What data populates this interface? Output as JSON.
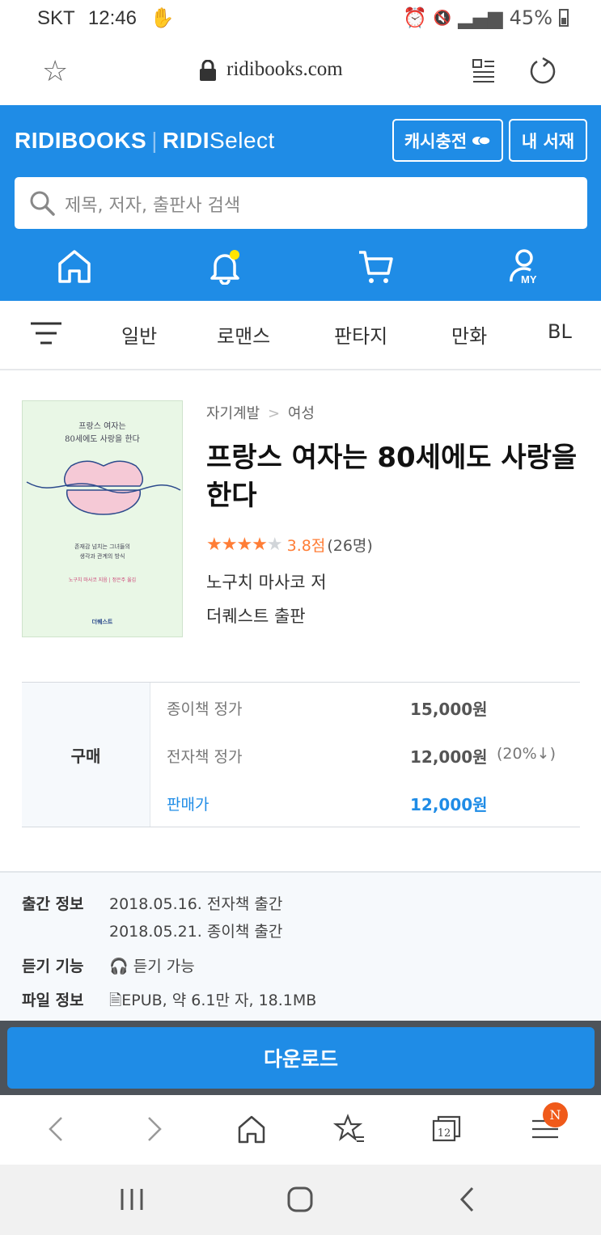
{
  "status_bar": {
    "carrier": "SKT",
    "time": "12:46",
    "battery": "45%"
  },
  "browser": {
    "url": "ridibooks.com"
  },
  "header": {
    "logo_ridibooks": "RIDIBOOKS",
    "logo_ridi": "RIDI",
    "logo_select": "Select",
    "cash_button": "캐시충전",
    "library_button": "내 서재",
    "search_placeholder": "제목, 저자, 출판사 검색"
  },
  "categories": [
    "일반",
    "로맨스",
    "판타지",
    "만화",
    "BL"
  ],
  "book": {
    "breadcrumb_parent": "자기계발",
    "breadcrumb_child": "여성",
    "title": "프랑스 여자는 80세에도 사랑을 한다",
    "rating_value": 3.8,
    "rating_score": "3.8점",
    "rating_count": "(26명)",
    "author": "노구치 마사코 저",
    "publisher": "더퀘스트 출판",
    "cover": {
      "title_line1": "프랑스 여자는",
      "title_line2": "80세에도 사랑을 한다",
      "subtitle_line1": "존재감 넘치는 그녀들의",
      "subtitle_line2": "생각과 관계의 방식",
      "author_line": "노구치 마사코 지음 | 정은주 옮김",
      "publisher_logo": "더퀘스트"
    }
  },
  "purchase": {
    "label": "구매",
    "rows": [
      {
        "name": "종이책 정가",
        "value": "15,000원",
        "discount": ""
      },
      {
        "name": "전자책 정가",
        "value": "12,000원",
        "discount": "(20%↓)"
      },
      {
        "name": "판매가",
        "value": "12,000원",
        "discount": ""
      }
    ]
  },
  "pub_info": {
    "release_label": "출간 정보",
    "release_ebook": "2018.05.16. 전자책 출간",
    "release_paper": "2018.05.21. 종이책 출간",
    "listen_label": "듣기 기능",
    "listen_value": "듣기 가능",
    "file_label": "파일 정보",
    "file_value": "EPUB, 약 6.1만 자, 18.1MB"
  },
  "download_button": "다운로드",
  "bottom_bar": {
    "tabs_count": "12",
    "menu_badge": "N"
  },
  "colors": {
    "brand_blue": "#1f8ce6",
    "star_orange": "#ff7d36",
    "badge_orange": "#f05a1a"
  }
}
